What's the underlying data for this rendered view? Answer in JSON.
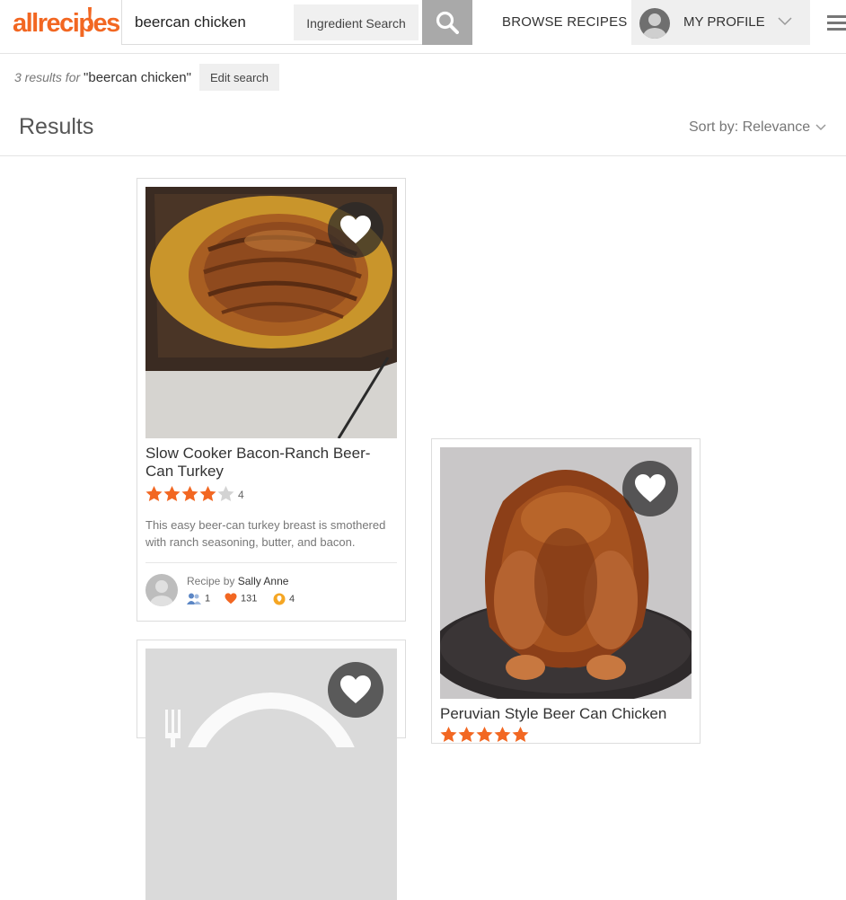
{
  "header": {
    "logo_text": "allrecipes",
    "search_value": "beercan chicken",
    "ingredient_search_label": "Ingredient Search",
    "browse_label": "BROWSE RECIPES",
    "profile_label": "MY PROFILE",
    "brand_color": "#f26722"
  },
  "results": {
    "count_text": "3 results for",
    "query_text": "\"beercan chicken\"",
    "edit_search_label": "Edit search",
    "heading": "Results",
    "sort_label": "Sort by: Relevance"
  },
  "cards": [
    {
      "title": "Slow Cooker Bacon-Ranch Beer-Can Turkey",
      "rating": 4,
      "rating_count": "4",
      "description": "This easy beer-can turkey breast is smothered with ranch seasoning, butter, and bacon.",
      "byline_prefix": "Recipe by",
      "author": "Sally Anne",
      "made_it": "1",
      "favorites": "131",
      "reviews": "4"
    },
    {
      "title": "Peruvian Style Beer Can Chicken",
      "rating": 5
    },
    {
      "title": "",
      "placeholder_image": true
    }
  ]
}
